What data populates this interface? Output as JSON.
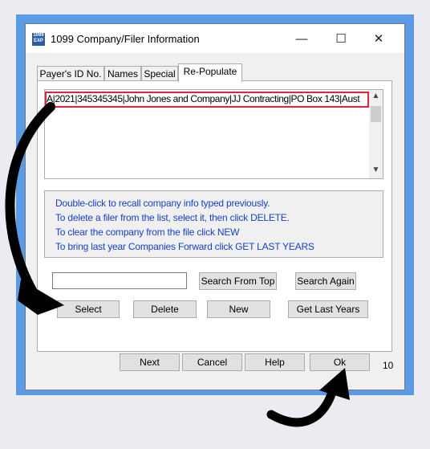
{
  "window": {
    "title": "1099 Company/Filer Information",
    "icon_text": "1099 EXP",
    "minimize": "—",
    "maximize": "☐",
    "close": "✕"
  },
  "tabs": [
    "Payer's ID No.",
    "Names",
    "Special",
    "Re-Populate"
  ],
  "list": {
    "rows": [
      "A|2021|345345345|John Jones and Company|JJ Contracting|PO Box 143|Aust"
    ]
  },
  "scrollbar": {
    "up": "▲",
    "down": "▼"
  },
  "info_lines": [
    "Double-click to recall company info typed previously.",
    "To delete a filer from the list, select it, then click DELETE.",
    "To clear the company from the file click NEW",
    "To bring last year Companies Forward click GET LAST YEARS"
  ],
  "search": {
    "value": "",
    "search_from_top": "Search From Top",
    "search_again": "Search Again"
  },
  "actions": {
    "select": "Select",
    "delete": "Delete",
    "new": "New",
    "get_last_years": "Get Last Years"
  },
  "footer": {
    "next": "Next",
    "cancel": "Cancel",
    "help": "Help",
    "ok": "Ok",
    "page_number": "10"
  },
  "colors": {
    "frame": "#5B9BE6",
    "highlight": "#E0243A",
    "info_text": "#1840C8",
    "arrow": "#000000"
  }
}
